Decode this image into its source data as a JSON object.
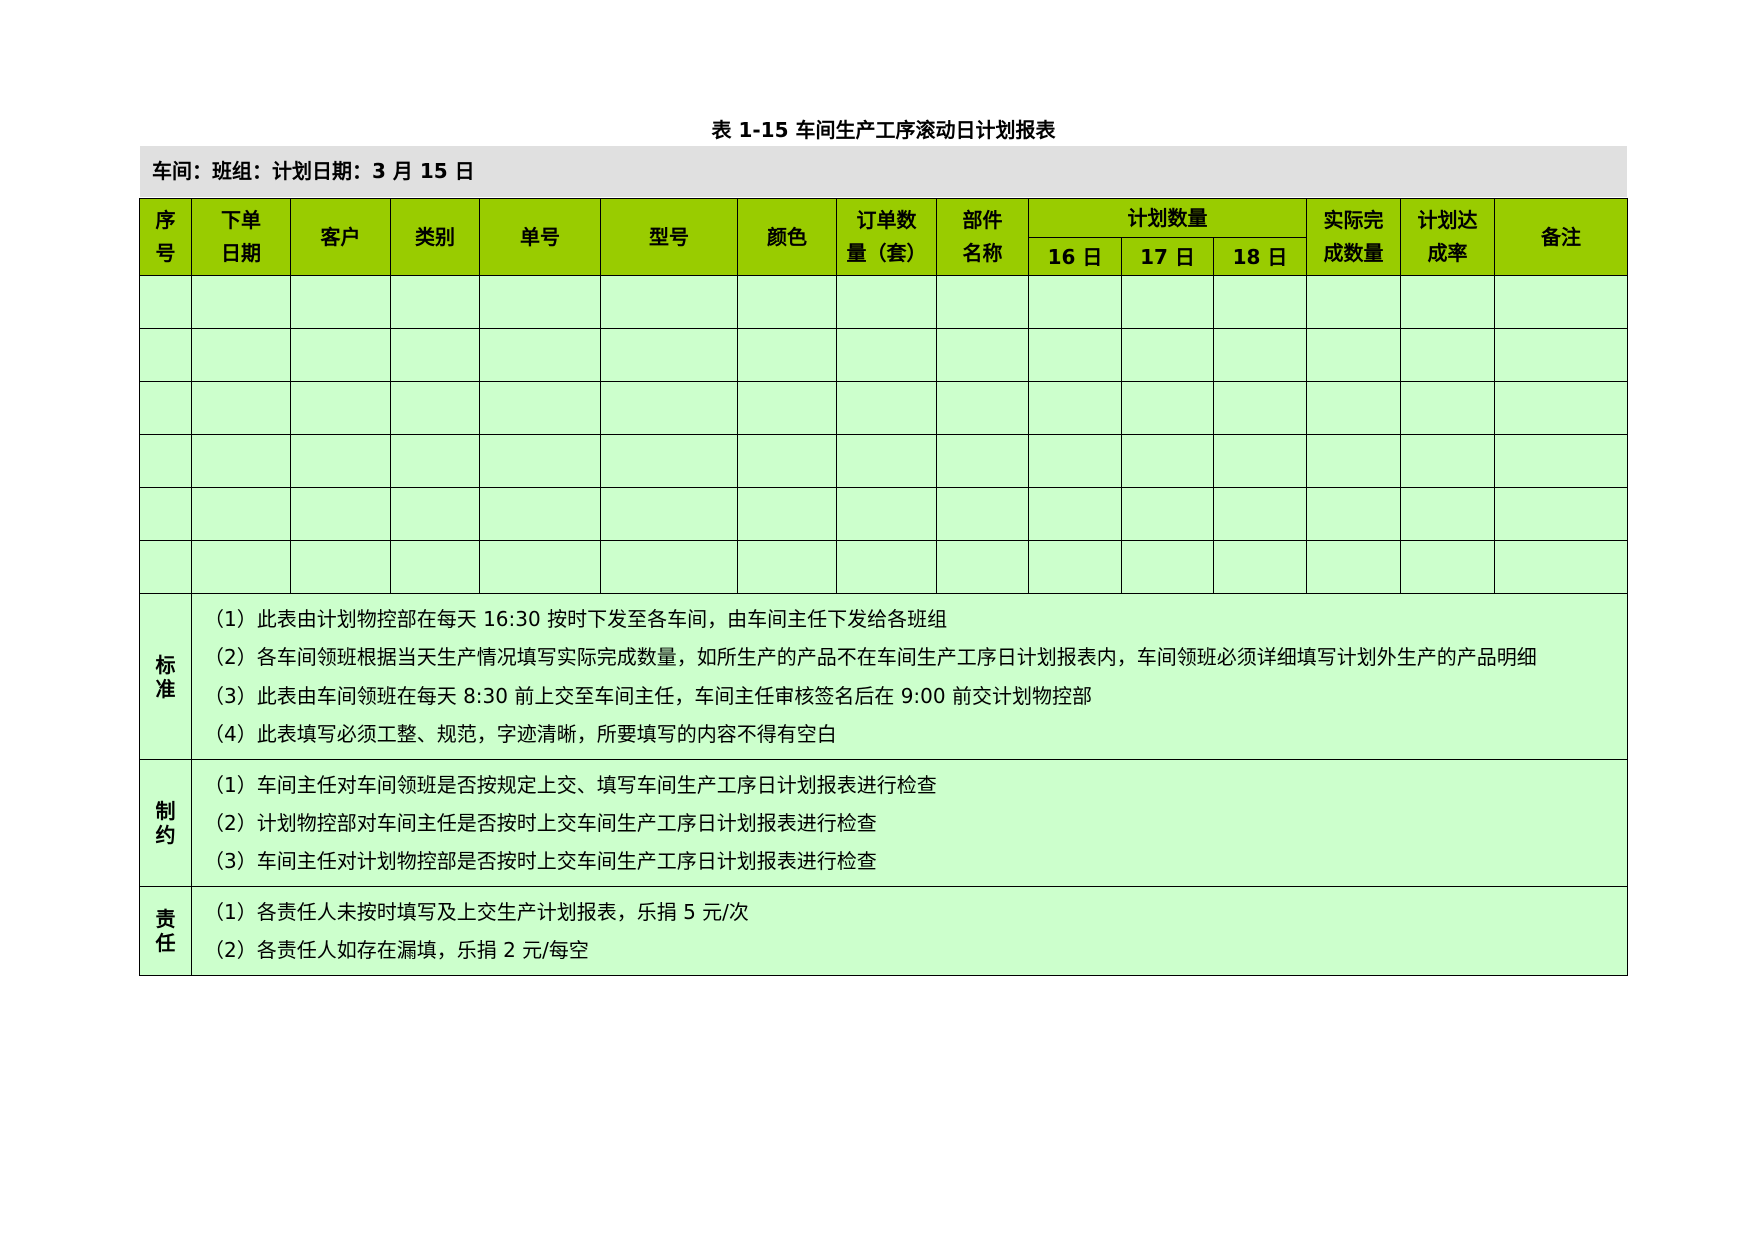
{
  "title": "表 1-15 车间生产工序滚动日计划报表",
  "info_line": "车间：班组：计划日期：3 月 15 日",
  "headers": {
    "seq_a": "序",
    "seq_b": "号",
    "date_a": "下单",
    "date_b": "日期",
    "customer": "客户",
    "category": "类别",
    "order_no": "单号",
    "model": "型号",
    "color": "颜色",
    "qty_a": "订单数",
    "qty_b": "量（套）",
    "part_a": "部件",
    "part_b": "名称",
    "plan_qty": "计划数量",
    "day16": "16 日",
    "day17": "17 日",
    "day18": "18 日",
    "actual_a": "实际完",
    "actual_b": "成数量",
    "rate_a": "计划达",
    "rate_b": "成率",
    "remark": "备注"
  },
  "empty_rows": 6,
  "sections": {
    "standard": {
      "label_a": "标",
      "label_b": "准",
      "lines": [
        "（1）此表由计划物控部在每天 16:30 按时下发至各车间，由车间主任下发给各班组",
        "（2）各车间领班根据当天生产情况填写实际完成数量，如所生产的产品不在车间生产工序日计划报表内，车间领班必须详细填写计划外生产的产品明细",
        "（3）此表由车间领班在每天 8:30 前上交至车间主任，车间主任审核签名后在 9:00 前交计划物控部",
        "（4）此表填写必须工整、规范，字迹清晰，所要填写的内容不得有空白"
      ]
    },
    "constraint": {
      "label_a": "制",
      "label_b": "约",
      "lines": [
        "（1）车间主任对车间领班是否按规定上交、填写车间生产工序日计划报表进行检查",
        "（2）计划物控部对车间主任是否按时上交车间生产工序日计划报表进行检查",
        "（3）车间主任对计划物控部是否按时上交车间生产工序日计划报表进行检查"
      ]
    },
    "responsibility": {
      "label_a": "责",
      "label_b": "任",
      "lines": [
        "（1）各责任人未按时填写及上交生产计划报表，乐捐 5 元/次",
        "（2）各责任人如存在漏填，乐捐 2 元/每空"
      ]
    }
  },
  "colors": {
    "header_bg": "#99cc00",
    "body_bg": "#ccffcc",
    "info_bg": "#e0e0e0"
  }
}
